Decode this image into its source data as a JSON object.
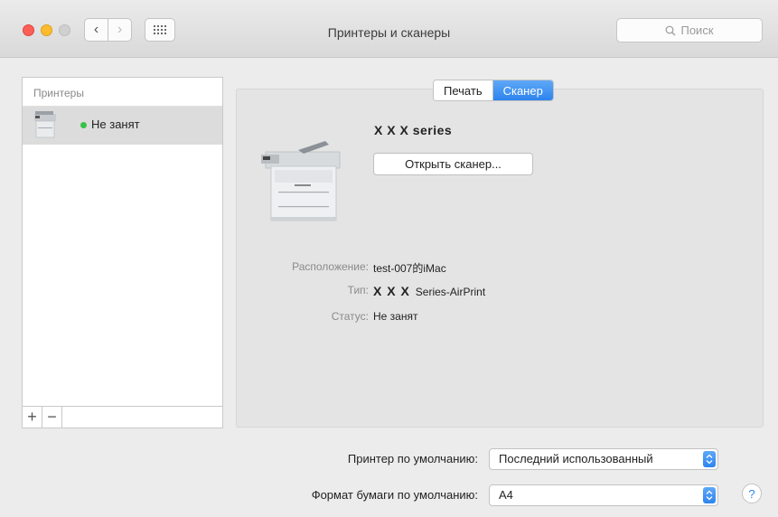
{
  "window": {
    "title": "Принтеры и сканеры"
  },
  "search": {
    "placeholder": "Поиск"
  },
  "sidebar": {
    "header": "Принтеры",
    "items": [
      {
        "status": "Не занят"
      }
    ],
    "add_label": "+",
    "remove_label": "−"
  },
  "tabs": [
    {
      "label": "Печать",
      "selected": false
    },
    {
      "label": "Сканер",
      "selected": true
    }
  ],
  "detail": {
    "model_prefix": "X X X",
    "model_suffix": "series",
    "open_button": "Открыть сканер...",
    "location_label": "Расположение:",
    "location_value": "test-007的iMac",
    "type_label": "Тип:",
    "type_prefix": "X X X",
    "type_value": "Series-AirPrint",
    "status_label": "Статус:",
    "status_value": "Не занят"
  },
  "settings": {
    "default_printer_label": "Принтер по умолчанию:",
    "default_printer_value": "Последний использованный",
    "paper_size_label": "Формат бумаги по умолчанию:",
    "paper_size_value": "A4"
  },
  "help_label": "?",
  "colors": {
    "accent": "#2d84ee",
    "status_green": "#36c24a",
    "close": "#fc5f57",
    "minimize": "#fdbc2e"
  },
  "icons": [
    "back-icon",
    "forward-icon",
    "grid-icon",
    "search-icon",
    "printer-icon",
    "help-icon",
    "up-down-arrows-icon"
  ]
}
